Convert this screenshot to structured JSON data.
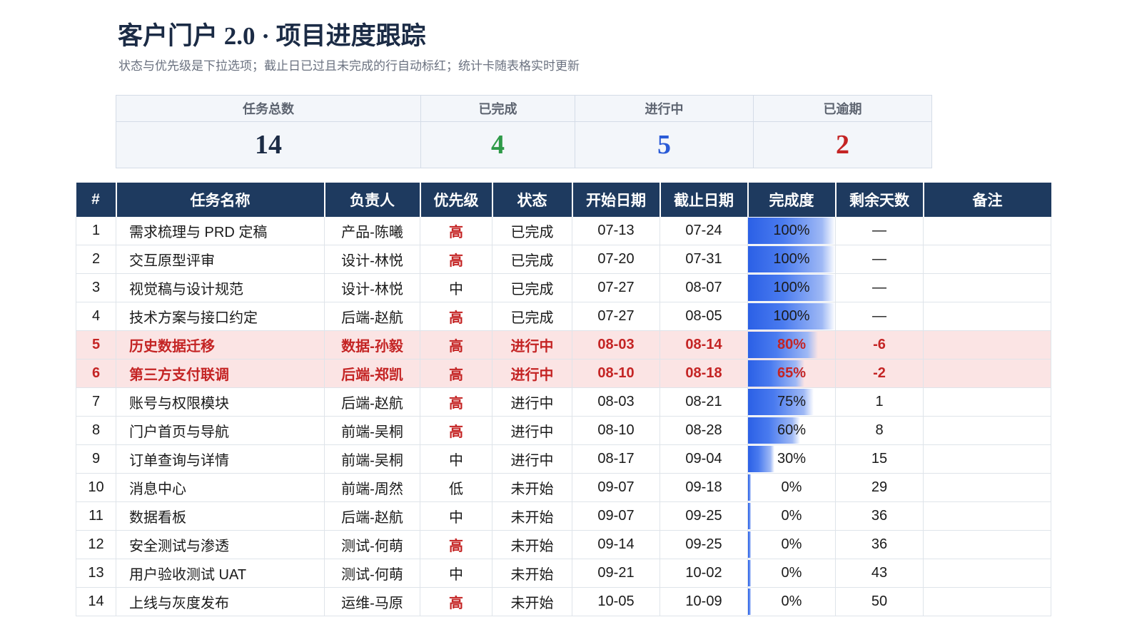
{
  "title": "客户门户 2.0 · 项目进度跟踪",
  "subtitle": "状态与优先级是下拉选项；截止日已过且未完成的行自动标红；统计卡随表格实时更新",
  "stats": [
    {
      "label": "任务总数",
      "value": "14",
      "color": "#1b2b45"
    },
    {
      "label": "已完成",
      "value": "4",
      "color": "#2e9a48"
    },
    {
      "label": "进行中",
      "value": "5",
      "color": "#2a5bd7"
    },
    {
      "label": "已逾期",
      "value": "2",
      "color": "#c42424"
    }
  ],
  "table": {
    "headers": [
      "#",
      "任务名称",
      "负责人",
      "优先级",
      "状态",
      "开始日期",
      "截止日期",
      "完成度",
      "剩余天数",
      "备注"
    ],
    "rows": [
      {
        "no": "1",
        "name": "需求梳理与 PRD 定稿",
        "owner": "产品-陈曦",
        "priority": "高",
        "status": "已完成",
        "start": "07-13",
        "due": "07-24",
        "progress": "100%",
        "remaining": "—",
        "note": "",
        "overdue": false
      },
      {
        "no": "2",
        "name": "交互原型评审",
        "owner": "设计-林悦",
        "priority": "高",
        "status": "已完成",
        "start": "07-20",
        "due": "07-31",
        "progress": "100%",
        "remaining": "—",
        "note": "",
        "overdue": false
      },
      {
        "no": "3",
        "name": "视觉稿与设计规范",
        "owner": "设计-林悦",
        "priority": "中",
        "status": "已完成",
        "start": "07-27",
        "due": "08-07",
        "progress": "100%",
        "remaining": "—",
        "note": "",
        "overdue": false
      },
      {
        "no": "4",
        "name": "技术方案与接口约定",
        "owner": "后端-赵航",
        "priority": "高",
        "status": "已完成",
        "start": "07-27",
        "due": "08-05",
        "progress": "100%",
        "remaining": "—",
        "note": "",
        "overdue": false
      },
      {
        "no": "5",
        "name": "历史数据迁移",
        "owner": "数据-孙毅",
        "priority": "高",
        "status": "进行中",
        "start": "08-03",
        "due": "08-14",
        "progress": "80%",
        "remaining": "-6",
        "note": "",
        "overdue": true
      },
      {
        "no": "6",
        "name": "第三方支付联调",
        "owner": "后端-郑凯",
        "priority": "高",
        "status": "进行中",
        "start": "08-10",
        "due": "08-18",
        "progress": "65%",
        "remaining": "-2",
        "note": "",
        "overdue": true
      },
      {
        "no": "7",
        "name": "账号与权限模块",
        "owner": "后端-赵航",
        "priority": "高",
        "status": "进行中",
        "start": "08-03",
        "due": "08-21",
        "progress": "75%",
        "remaining": "1",
        "note": "",
        "overdue": false
      },
      {
        "no": "8",
        "name": "门户首页与导航",
        "owner": "前端-吴桐",
        "priority": "高",
        "status": "进行中",
        "start": "08-10",
        "due": "08-28",
        "progress": "60%",
        "remaining": "8",
        "note": "",
        "overdue": false
      },
      {
        "no": "9",
        "name": "订单查询与详情",
        "owner": "前端-吴桐",
        "priority": "中",
        "status": "进行中",
        "start": "08-17",
        "due": "09-04",
        "progress": "30%",
        "remaining": "15",
        "note": "",
        "overdue": false
      },
      {
        "no": "10",
        "name": "消息中心",
        "owner": "前端-周然",
        "priority": "低",
        "status": "未开始",
        "start": "09-07",
        "due": "09-18",
        "progress": "0%",
        "remaining": "29",
        "note": "",
        "overdue": false
      },
      {
        "no": "11",
        "name": "数据看板",
        "owner": "后端-赵航",
        "priority": "中",
        "status": "未开始",
        "start": "09-07",
        "due": "09-25",
        "progress": "0%",
        "remaining": "36",
        "note": "",
        "overdue": false
      },
      {
        "no": "12",
        "name": "安全测试与渗透",
        "owner": "测试-何萌",
        "priority": "高",
        "status": "未开始",
        "start": "09-14",
        "due": "09-25",
        "progress": "0%",
        "remaining": "36",
        "note": "",
        "overdue": false
      },
      {
        "no": "13",
        "name": "用户验收测试 UAT",
        "owner": "测试-何萌",
        "priority": "中",
        "status": "未开始",
        "start": "09-21",
        "due": "10-02",
        "progress": "0%",
        "remaining": "43",
        "note": "",
        "overdue": false
      },
      {
        "no": "14",
        "name": "上线与灰度发布",
        "owner": "运维-马原",
        "priority": "高",
        "status": "未开始",
        "start": "10-05",
        "due": "10-09",
        "progress": "0%",
        "remaining": "50",
        "note": "",
        "overdue": false
      }
    ]
  },
  "colors": {
    "header_bg": "#1e3a5f",
    "priority_high": "#c42424",
    "overdue_bg": "#fbe4e4",
    "progress_bar": "#2b60e6"
  }
}
